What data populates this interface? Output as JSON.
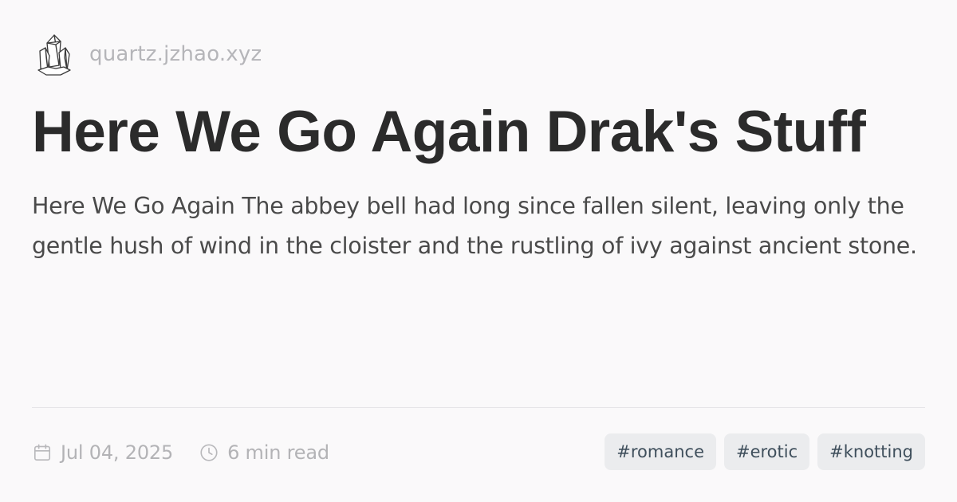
{
  "site": {
    "name": "quartz.jzhao.xyz",
    "logo_icon": "crystal-cluster-icon"
  },
  "page": {
    "title": "Here We Go Again Drak's Stuff",
    "description": "Here We Go Again The abbey bell had long since fallen silent, leaving only the gentle hush of wind in the cloister and the rustling of ivy against ancient stone."
  },
  "meta": {
    "date": "Jul 04, 2025",
    "date_icon": "calendar-icon",
    "reading_time": "6 min read",
    "reading_time_icon": "clock-icon"
  },
  "tags": [
    {
      "label": "#romance"
    },
    {
      "label": "#erotic"
    },
    {
      "label": "#knotting"
    }
  ],
  "colors": {
    "background": "#faf9fa",
    "title": "#2b2b2b",
    "muted": "#b3b3b6",
    "tag_background": "#ebecee",
    "tag_text": "#3f4f5c",
    "divider": "#e6e5e8"
  }
}
